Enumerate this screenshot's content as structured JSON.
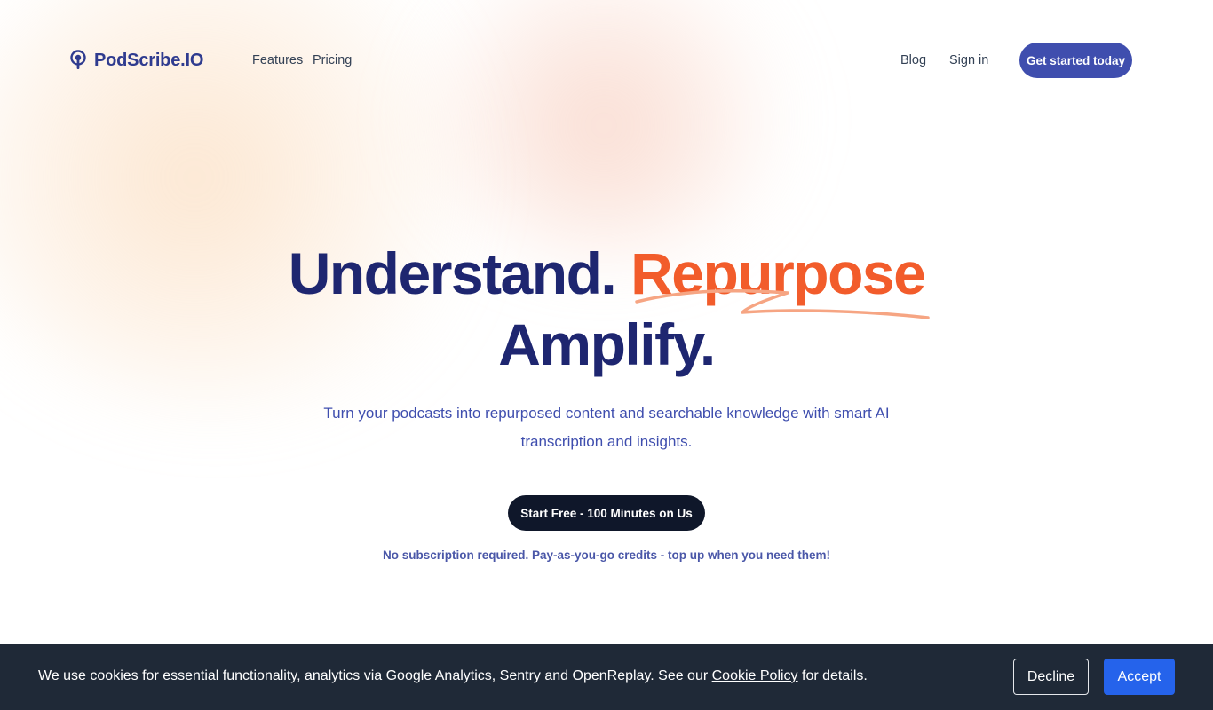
{
  "brand": {
    "name": "PodScribe.IO",
    "icon": "podcast-mic-icon",
    "color": "#2f3b8f"
  },
  "nav": {
    "left": [
      {
        "label": "Features"
      },
      {
        "label": "Pricing"
      }
    ],
    "right": [
      {
        "label": "Blog"
      },
      {
        "label": "Sign in"
      }
    ],
    "cta_label": "Get started today"
  },
  "hero": {
    "title_part1": "Understand.",
    "title_accent": "Repurpose",
    "title_line2": "Amplify.",
    "subtitle": "Turn your podcasts into repurposed content and searchable knowledge with smart AI transcription and insights.",
    "start_button": "Start Free - 100 Minutes on Us",
    "note": "No subscription required. Pay-as-you-go credits - top up when you need them!"
  },
  "cookie": {
    "text_before": "We use cookies for essential functionality, analytics via Google Analytics, Sentry and OpenReplay. See our ",
    "link_label": "Cookie Policy",
    "text_after": " for details.",
    "decline_label": "Decline",
    "accept_label": "Accept"
  },
  "colors": {
    "primary": "#3f4eae",
    "title": "#1e2670",
    "accent": "#f25c2b",
    "dark_button": "#0f172a",
    "cookie_bg": "#1f2937",
    "accept": "#2563eb"
  }
}
